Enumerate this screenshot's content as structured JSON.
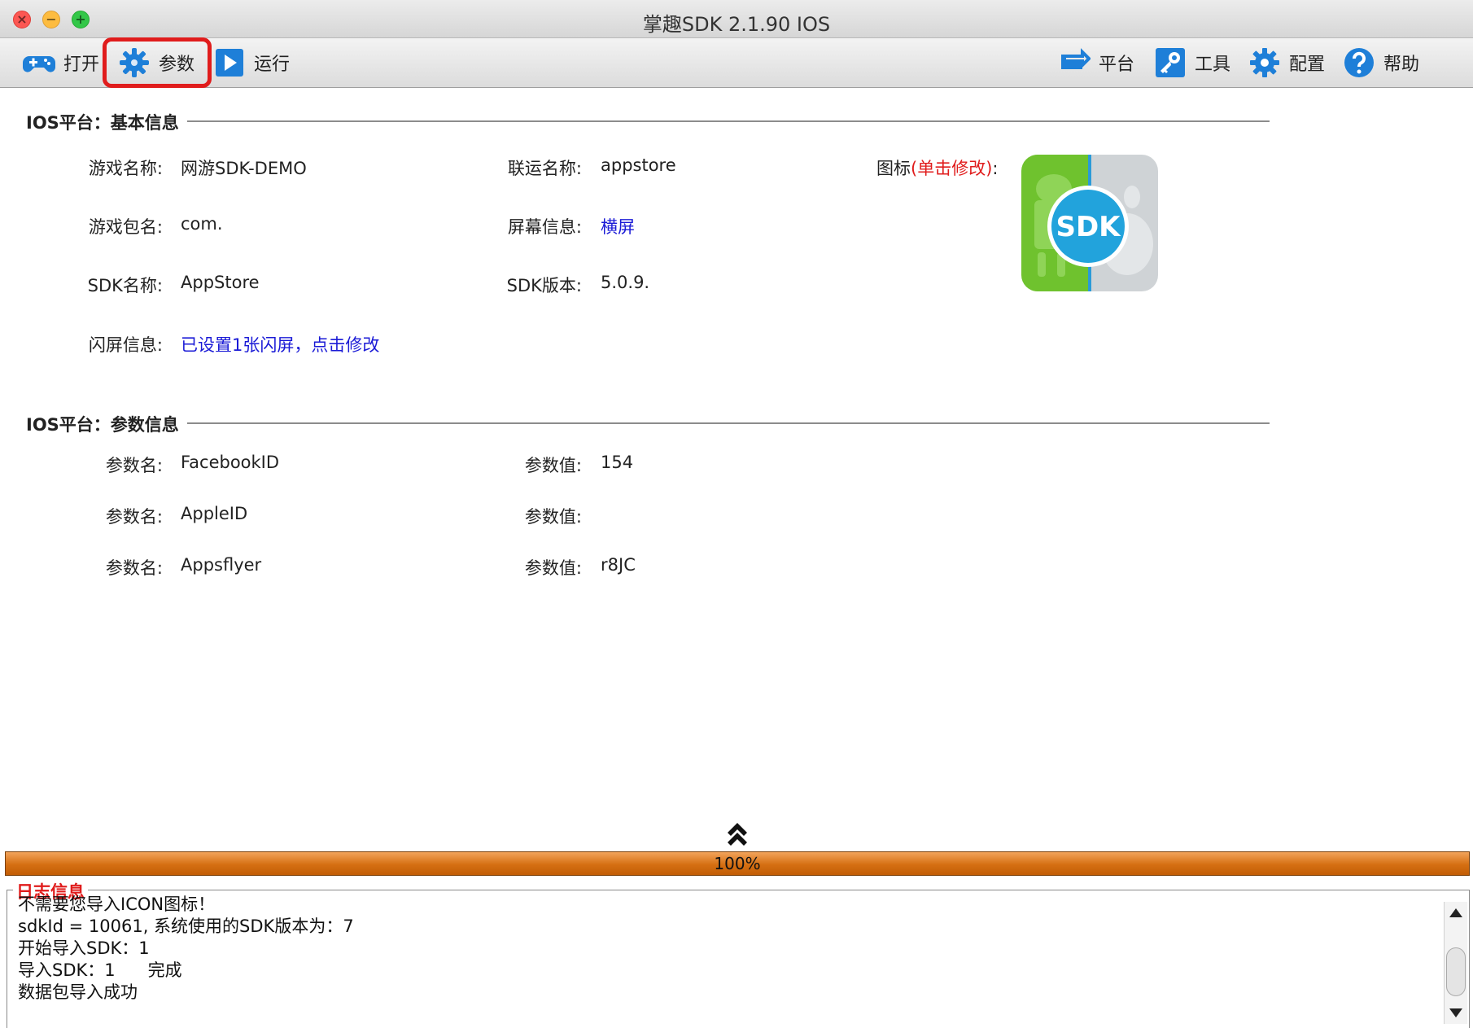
{
  "window": {
    "title": "掌趣SDK 2.1.90  IOS",
    "controls": {
      "close": "×",
      "minimize": "−",
      "maximize": "+"
    }
  },
  "toolbar": {
    "open_label": "打开",
    "params_label": "参数",
    "run_label": "运行",
    "platform_label": "平台",
    "tools_label": "工具",
    "config_label": "配置",
    "help_label": "帮助"
  },
  "basic_info": {
    "title": "IOS平台：基本信息",
    "game_name_label": "游戏名称:",
    "game_name_value": "网游SDK-DEMO",
    "channel_name_label": "联运名称:",
    "channel_name_value": "appstore",
    "icon_label": "图标",
    "icon_hint": "(单击修改)",
    "icon_colon": ":",
    "package_label": "游戏包名:",
    "package_value": "com.",
    "screen_label": "屏幕信息:",
    "screen_value": "横屏",
    "sdk_name_label": "SDK名称:",
    "sdk_name_value": "AppStore",
    "sdk_version_label": "SDK版本:",
    "sdk_version_value": "5.0.9.",
    "splash_label": "闪屏信息:",
    "splash_value": "已设置1张闪屏，点击修改",
    "icon_logo_text": "SDK"
  },
  "param_info": {
    "title": "IOS平台：参数信息",
    "rows": [
      {
        "name_label": "参数名:",
        "name": "FacebookID",
        "value_label": "参数值:",
        "value": "154"
      },
      {
        "name_label": "参数名:",
        "name": "AppleID",
        "value_label": "参数值:",
        "value": ""
      },
      {
        "name_label": "参数名:",
        "name": "Appsflyer",
        "value_label": "参数值:",
        "value": "r8JC"
      }
    ]
  },
  "progress": {
    "percent": 100,
    "text": "100%"
  },
  "log": {
    "title": "日志信息",
    "lines": [
      "不需要您导入ICON图标！",
      "sdkId = 10061, 系统使用的SDK版本为：7",
      "开始导入SDK：1",
      "导入SDK：1",
      "数据包导入成功"
    ],
    "line4_suffix": "完成"
  },
  "colors": {
    "accent_red": "#e01c1c",
    "link_blue": "#1a1ad6",
    "progress_orange": "#d56f12",
    "icon_blue": "#1e7fd8"
  }
}
